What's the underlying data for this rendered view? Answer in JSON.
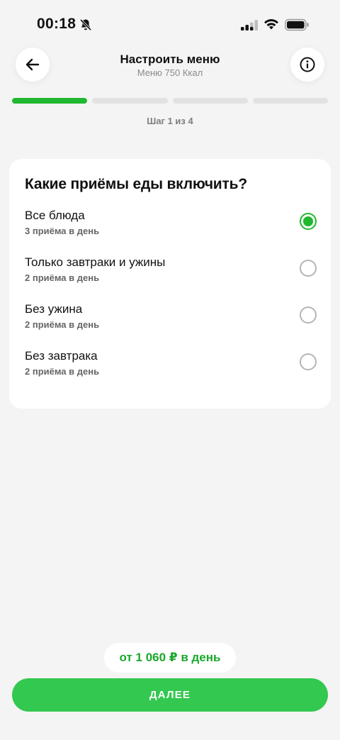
{
  "status_bar": {
    "time": "00:18",
    "icons": [
      "bell-slash-icon",
      "signal-icon",
      "wifi-icon",
      "battery-icon"
    ]
  },
  "header": {
    "title": "Настроить меню",
    "subtitle": "Меню 750 Ккал",
    "back_icon": "arrow-left-icon",
    "info_icon": "info-icon"
  },
  "progress": {
    "current_step": 1,
    "total_steps": 4,
    "label": "Шаг 1 из 4"
  },
  "card": {
    "title": "Какие приёмы еды включить?",
    "options": [
      {
        "label": "Все блюда",
        "sub": "3 приёма в день",
        "selected": true
      },
      {
        "label": "Только завтраки и ужины",
        "sub": "2 приёма в день",
        "selected": false
      },
      {
        "label": "Без ужина",
        "sub": "2 приёма в день",
        "selected": false
      },
      {
        "label": "Без завтрака",
        "sub": "2 приёма в день",
        "selected": false
      }
    ]
  },
  "footer": {
    "price": "от 1 060 ₽ в день",
    "next_label": "ДАЛЕЕ"
  },
  "colors": {
    "accent": "#1fb830",
    "button": "#33c84f",
    "background": "#f4f4f4"
  }
}
